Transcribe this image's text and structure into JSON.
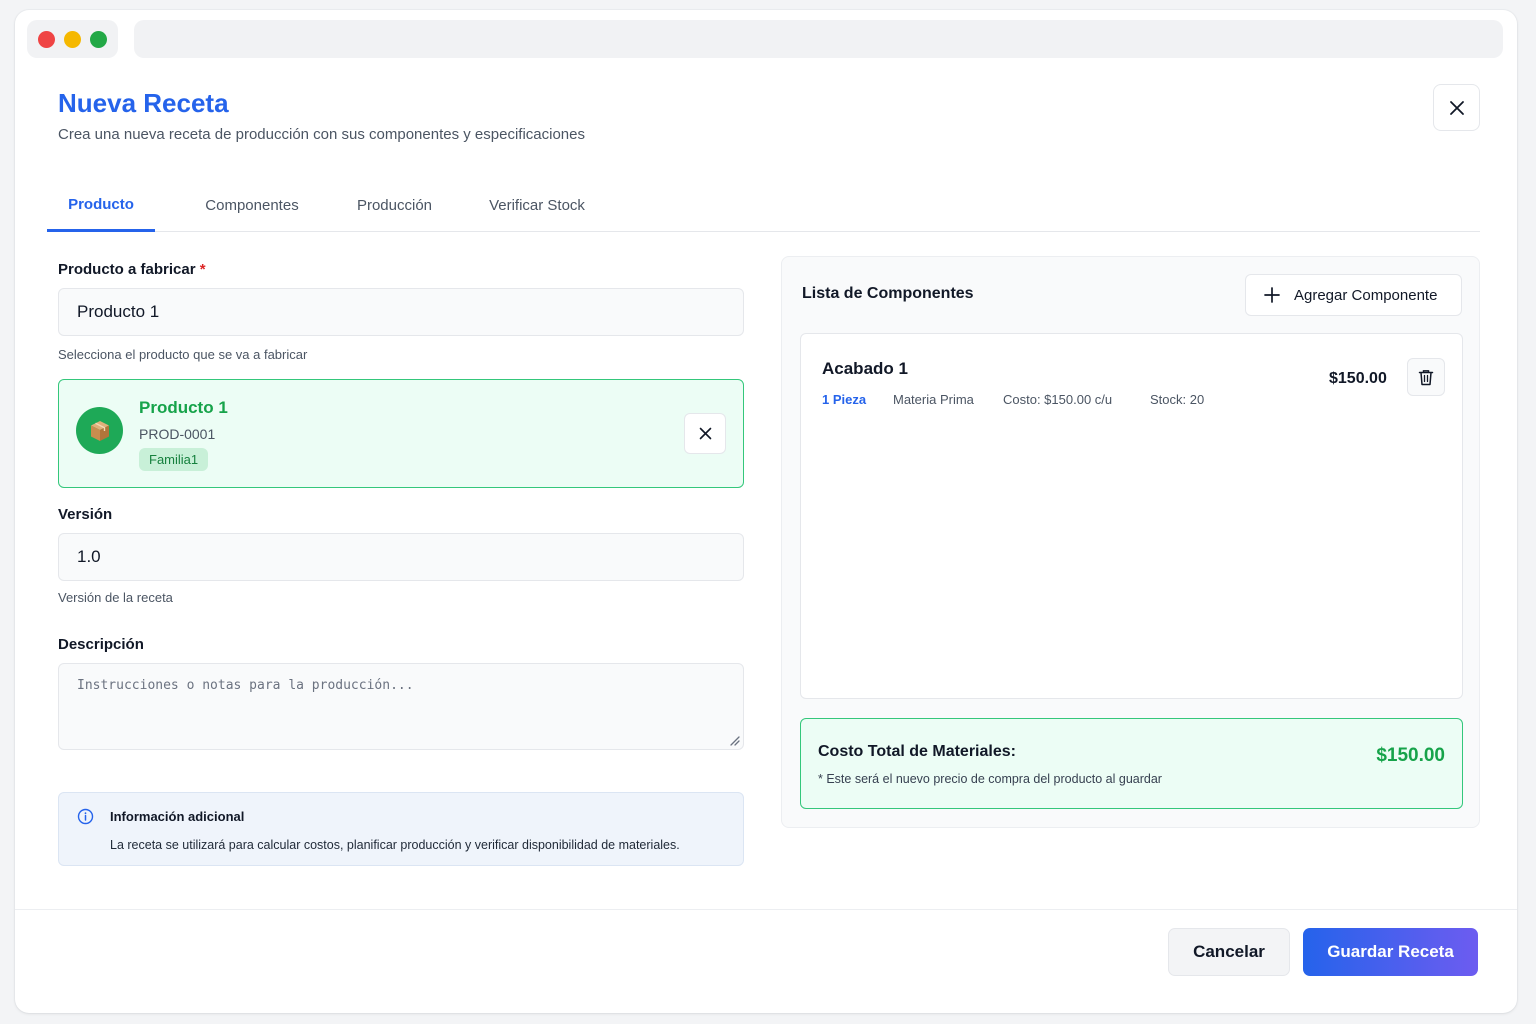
{
  "header": {
    "title": "Nueva Receta",
    "subtitle": "Crea una nueva receta de producción con sus componentes y especificaciones"
  },
  "tabs": [
    {
      "label": "Producto",
      "active": true
    },
    {
      "label": "Componentes",
      "active": false
    },
    {
      "label": "Producción",
      "active": false
    },
    {
      "label": "Verificar Stock",
      "active": false
    }
  ],
  "form": {
    "product": {
      "label": "Producto a fabricar",
      "required_mark": "*",
      "value": "Producto 1",
      "help": "Selecciona el producto que se va a fabricar"
    },
    "selected_product": {
      "name": "Producto 1",
      "code": "PROD-0001",
      "family": "Familia1",
      "icon": "box-icon"
    },
    "version": {
      "label": "Versión",
      "value": "1.0",
      "help": "Versión de la receta"
    },
    "description": {
      "label": "Descripción",
      "placeholder": "Instrucciones o notas para la producción..."
    },
    "info": {
      "title": "Información adicional",
      "text": "La receta se utilizará para calcular costos, planificar producción y verificar disponibilidad de materiales."
    }
  },
  "components_panel": {
    "title": "Lista de Componentes",
    "add_label": "Agregar Componente",
    "items": [
      {
        "name": "Acabado 1",
        "quantity": "1 Pieza",
        "type": "Materia Prima",
        "cost": "Costo: $150.00 c/u",
        "stock": "Stock: 20",
        "price": "$150.00"
      }
    ],
    "total": {
      "label": "Costo Total de Materiales:",
      "note": "* Este será el nuevo precio de compra del producto al guardar",
      "value": "$150.00"
    }
  },
  "footer": {
    "cancel_label": "Cancelar",
    "save_label": "Guardar Receta"
  },
  "colors": {
    "accent": "#2563eb",
    "success": "#16a34a",
    "success_bg": "#ecfdf5"
  }
}
